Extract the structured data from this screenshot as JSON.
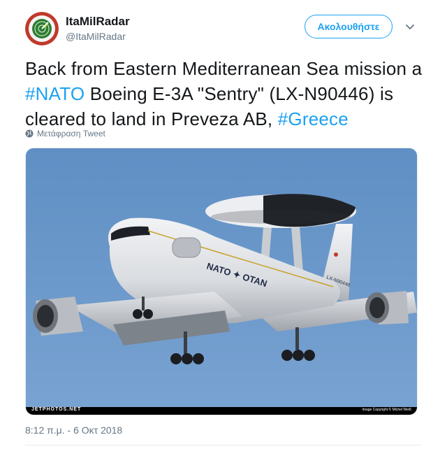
{
  "header": {
    "display_name": "ItaMilRadar",
    "handle": "@ItaMilRadar",
    "follow_label": "Ακολουθήστε",
    "avatar_icon": "radar-logo-icon",
    "menu_icon": "chevron-down-icon"
  },
  "tweet": {
    "text_part1": "Back from Eastern Mediterranean Sea mission a ",
    "hashtag1": "#NATO",
    "text_part2": " Boeing E-3A \"Sentry\" (LX-N90446) is cleared to land in Preveza AB, ",
    "hashtag2": "#Greece",
    "translate_label": "Μετάφραση Tweet",
    "translate_icon": "globe-icon"
  },
  "media": {
    "watermark_left": "JETPHOTOS.NET",
    "watermark_right": "Image Copyright © Michel Weiß",
    "aircraft_fuselage_text": "NATO ✦ OTAN",
    "aircraft_tail_text": "LX-N90446"
  },
  "footer": {
    "timestamp": "8:12 π.μ. - 6 Οκτ 2018"
  },
  "colors": {
    "accent": "#1da1f2",
    "sky": "#6d98c9",
    "secondary_text": "#657786"
  }
}
